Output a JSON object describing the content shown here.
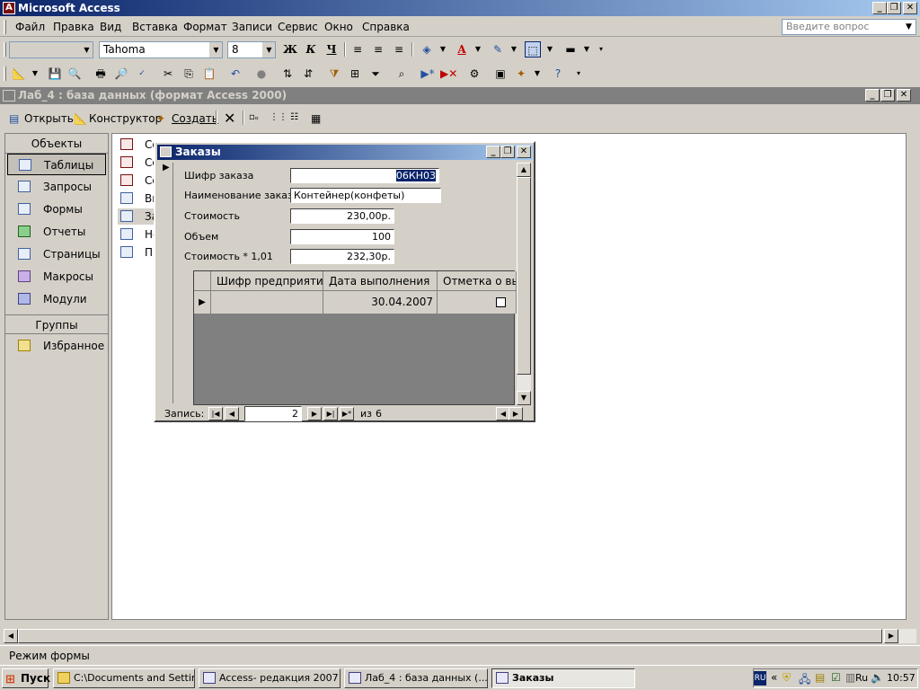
{
  "app": {
    "title": "Microsoft Access"
  },
  "menu": {
    "items": [
      "Файл",
      "Правка",
      "Вид",
      "Вставка",
      "Формат",
      "Записи",
      "Сервис",
      "Окно",
      "Справка"
    ],
    "ask_placeholder": "Введите вопрос"
  },
  "format_toolbar": {
    "object_combo": "",
    "font": "Tahoma",
    "size": "8"
  },
  "db_window": {
    "title": "Лаб_4 : база данных (формат Access 2000)",
    "toolbar": {
      "open": "Открыть",
      "design": "Конструктор",
      "create": "Создать"
    },
    "objects_header": "Объекты",
    "objects": [
      "Таблицы",
      "Запросы",
      "Формы",
      "Отчеты",
      "Страницы",
      "Макросы",
      "Модули"
    ],
    "groups_header": "Группы",
    "groups": [
      "Избранное"
    ],
    "list_items": [
      "Со",
      "Со",
      "Со",
      "Вы",
      "За",
      "Не",
      "Пр"
    ]
  },
  "form": {
    "title": "Заказы",
    "fields": [
      {
        "label": "Шифр заказа",
        "value": "06КН03"
      },
      {
        "label": "Наименование заказа",
        "value": "Контейнер(конфеты)"
      },
      {
        "label": "Стоимость",
        "value": "230,00р."
      },
      {
        "label": "Объем",
        "value": "100"
      },
      {
        "label": "Стоимость * 1,01",
        "value": "232,30р."
      }
    ],
    "subform": {
      "columns": [
        "Шифр предприятия",
        "Дата выполнения",
        "Отметка о вып"
      ],
      "row": {
        "enterprise": "",
        "date": "30.04.2007",
        "done": false
      }
    },
    "nav": {
      "label": "Запись:",
      "current": "2",
      "of_label": "из",
      "total": "6"
    }
  },
  "status": {
    "text": "Режим формы"
  },
  "taskbar": {
    "start": "Пуск",
    "tasks": [
      "C:\\Documents and Settin...",
      "Access- редакция 2007 ...",
      "Лаб_4 : база данных (...",
      "Заказы"
    ],
    "lang": "RU",
    "lang2": "Ru",
    "clock": "10:57"
  }
}
